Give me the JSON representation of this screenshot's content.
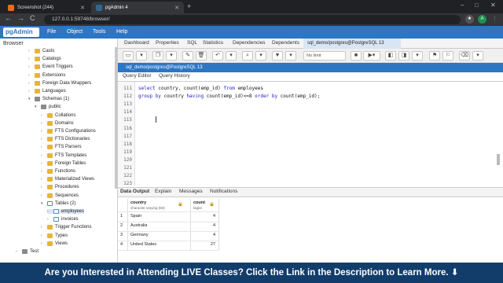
{
  "browser": {
    "tabs": [
      {
        "label": "Screenshot (244)",
        "favicon": "document-icon"
      },
      {
        "label": "pgAdmin 4",
        "favicon": "pgadmin-icon"
      }
    ],
    "new_tab": "+",
    "window_controls": [
      "–",
      "□",
      "✕"
    ],
    "url": "127.0.0.1:59748/browser/",
    "nav": [
      "←",
      "→",
      "C"
    ],
    "profile": "A"
  },
  "app": {
    "logo": "pgAdmin",
    "menu": [
      "File",
      "Object",
      "Tools",
      "Help"
    ]
  },
  "sidebar": {
    "title": "Browser",
    "items": [
      {
        "label": "Casts",
        "indent": 4
      },
      {
        "label": "Catalogs",
        "indent": 4
      },
      {
        "label": "Event Triggers",
        "indent": 4
      },
      {
        "label": "Extensions",
        "indent": 4
      },
      {
        "label": "Foreign Data Wrappers",
        "indent": 4
      },
      {
        "label": "Languages",
        "indent": 4
      },
      {
        "label": "Schemas (1)",
        "indent": 4
      },
      {
        "label": "public",
        "indent": 5
      },
      {
        "label": "Collations",
        "indent": 6
      },
      {
        "label": "Domains",
        "indent": 6
      },
      {
        "label": "FTS Configurations",
        "indent": 6
      },
      {
        "label": "FTS Dictionaries",
        "indent": 6
      },
      {
        "label": "FTS Parsers",
        "indent": 6
      },
      {
        "label": "FTS Templates",
        "indent": 6
      },
      {
        "label": "Foreign Tables",
        "indent": 6
      },
      {
        "label": "Functions",
        "indent": 6
      },
      {
        "label": "Materialized Views",
        "indent": 6
      },
      {
        "label": "Procedures",
        "indent": 6
      },
      {
        "label": "Sequences",
        "indent": 6
      },
      {
        "label": "Tables (2)",
        "indent": 6
      },
      {
        "label": "employees",
        "indent": 7
      },
      {
        "label": "invoices",
        "indent": 7
      },
      {
        "label": "Trigger Functions",
        "indent": 6
      },
      {
        "label": "Types",
        "indent": 6
      },
      {
        "label": "Views",
        "indent": 6
      },
      {
        "label": "Test",
        "indent": 2
      }
    ]
  },
  "panel_tabs": [
    "Dashboard",
    "Properties",
    "SQL",
    "Statistics",
    "Dependencies",
    "Dependents"
  ],
  "query_tab": "sql_demo/postgres@PostgreSQL 13",
  "toolbar": {
    "limit": "No limit"
  },
  "connection": "sql_demo/postgres@PostgreSQL 13",
  "editor_tabs": [
    "Query Editor",
    "Query History"
  ],
  "editor": {
    "lines": [
      {
        "num": "111",
        "code": "select country, count(emp_id) from employees"
      },
      {
        "num": "112",
        "code": "group by country having count(emp_id)<=8 order by count(emp_id);"
      },
      {
        "num": "113",
        "code": ""
      },
      {
        "num": "114",
        "code": ""
      },
      {
        "num": "115",
        "code": ""
      },
      {
        "num": "116",
        "code": ""
      },
      {
        "num": "117",
        "code": ""
      },
      {
        "num": "118",
        "code": ""
      },
      {
        "num": "119",
        "code": ""
      },
      {
        "num": "120",
        "code": ""
      },
      {
        "num": "121",
        "code": ""
      },
      {
        "num": "122",
        "code": ""
      },
      {
        "num": "123",
        "code": ""
      }
    ]
  },
  "result_tabs": [
    "Data Output",
    "Explain",
    "Messages",
    "Notifications"
  ],
  "results": {
    "columns": [
      {
        "name": "country",
        "type": "character varying (50)"
      },
      {
        "name": "count",
        "type": "bigint"
      }
    ],
    "rows": [
      {
        "n": "1",
        "country": "Spain",
        "count": "4"
      },
      {
        "n": "2",
        "country": "Australia",
        "count": "4"
      },
      {
        "n": "3",
        "country": "Germany",
        "count": "4"
      },
      {
        "n": "4",
        "country": "United States",
        "count": "27"
      }
    ]
  },
  "banner": "Are you Interested in Attending LIVE Classes? Click the Link in the Description to Learn More. ⬇"
}
